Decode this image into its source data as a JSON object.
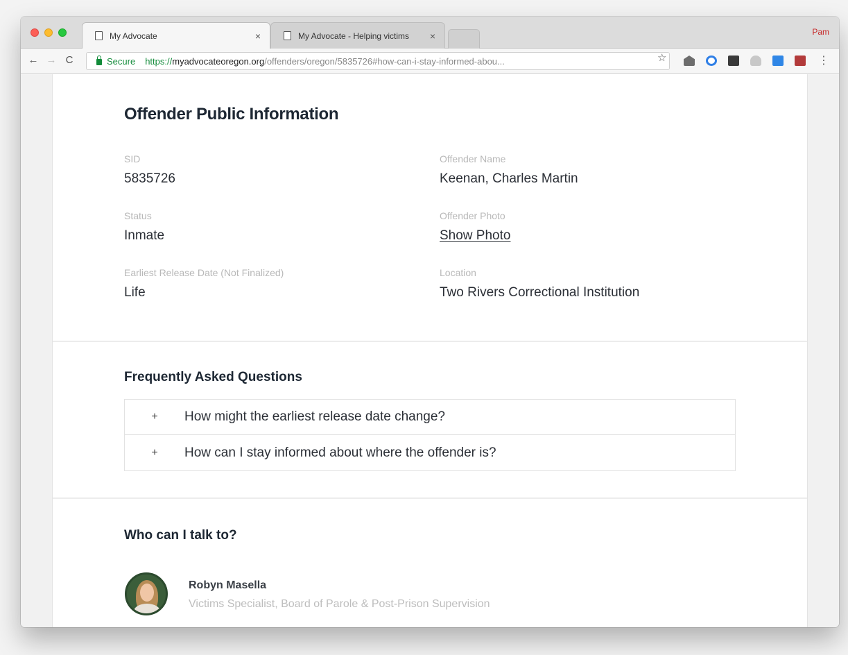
{
  "browser": {
    "tabs": [
      {
        "title": "My Advocate",
        "close": "×"
      },
      {
        "title": "My Advocate - Helping victims",
        "close": "×"
      }
    ],
    "profile_name": "Pam",
    "address": {
      "secure_label": "Secure",
      "scheme": "https://",
      "host": "myadvocateoregon.org",
      "path": "/offenders/oregon/5835726#how-can-i-stay-informed-abou..."
    },
    "icons": {
      "back": "←",
      "forward": "→",
      "reload": "C",
      "star": "☆",
      "menu": "⋮"
    }
  },
  "page": {
    "title": "Offender Public Information",
    "fields": {
      "sid": {
        "label": "SID",
        "value": "5835726"
      },
      "name": {
        "label": "Offender Name",
        "value": "Keenan, Charles Martin"
      },
      "status": {
        "label": "Status",
        "value": "Inmate"
      },
      "photo": {
        "label": "Offender Photo",
        "value": "Show Photo"
      },
      "release": {
        "label": "Earliest Release Date (Not Finalized)",
        "value": "Life"
      },
      "location": {
        "label": "Location",
        "value": "Two Rivers Correctional Institution"
      }
    },
    "faq": {
      "title": "Frequently Asked Questions",
      "items": [
        {
          "icon": "+",
          "question": "How might the earliest release date change?"
        },
        {
          "icon": "+",
          "question": "How can I stay informed about where the offender is?"
        }
      ]
    },
    "contact": {
      "title": "Who can I talk to?",
      "name": "Robyn Masella",
      "role": "Victims Specialist, Board of Parole & Post-Prison Supervision"
    }
  }
}
